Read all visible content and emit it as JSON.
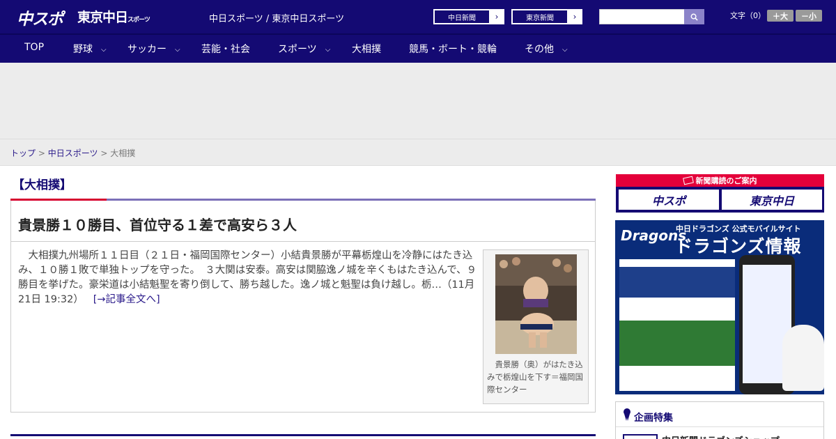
{
  "header": {
    "logo_main": "中スポ",
    "logo_tokyo": "東京中日",
    "logo_tokyo_small": "スポーツ",
    "site_title": "中日スポーツ / 東京中日スポーツ",
    "paper_links": [
      {
        "label": "中日新聞"
      },
      {
        "label": "東京新聞"
      }
    ],
    "search_placeholder": "",
    "font_size_label": "文字（0）",
    "font_up": "＋大",
    "font_down": "－小"
  },
  "nav": [
    {
      "label": "TOP",
      "dropdown": false
    },
    {
      "label": "野球",
      "dropdown": true
    },
    {
      "label": "サッカー",
      "dropdown": true
    },
    {
      "label": "芸能・社会",
      "dropdown": false
    },
    {
      "label": "スポーツ",
      "dropdown": true
    },
    {
      "label": "大相撲",
      "dropdown": false
    },
    {
      "label": "競馬・ボート・競輪",
      "dropdown": false
    },
    {
      "label": "その他",
      "dropdown": true
    }
  ],
  "breadcrumb": {
    "items": [
      "トップ",
      "中日スポーツ"
    ],
    "separator": ">",
    "current": "大相撲"
  },
  "category": "【大相撲】",
  "article": {
    "title": "貴景勝１０勝目、首位守る１差で高安ら３人",
    "body": "　大相撲九州場所１１日目（２１日・福岡国際センター）小結貴景勝が平幕栃煌山を冷静にはたき込み、１０勝１敗で単独トップを守った。　３大関は安泰。高安は関脇逸ノ城を辛くもはたき込んで、９勝目を挙げた。豪栄道は小結魁聖を寄り倒して、勝ち越した。逸ノ城と魁聖は負け越し。栃…（11月21日 19:32）",
    "read_more": "[→記事全文へ]",
    "photo_caption": "　貴景勝（奥）がはたき込みで栃煌山を下す＝福岡国際センター"
  },
  "sidebar": {
    "subscription_head": "新聞購読のご案内",
    "subscription_logos": [
      "中スポ",
      "東京中日"
    ],
    "dragons": {
      "logo": "Dragons",
      "subtitle": "中日ドラゴンズ 公式モバイルサイト",
      "title": "ドラゴンズ情報"
    },
    "feature_title": "企画特集",
    "feature_item": "中日新聞ドラゴンズショップ"
  },
  "colors": {
    "brand_navy": "#140a73",
    "accent_red": "#d6002f",
    "link": "#2a1a8a"
  }
}
